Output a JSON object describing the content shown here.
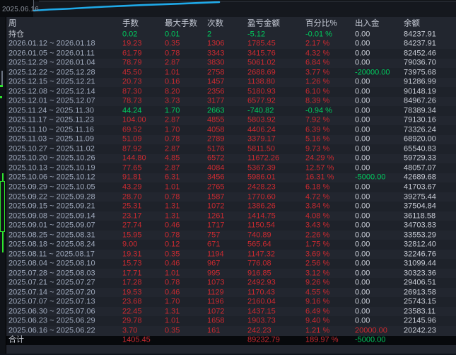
{
  "window": {
    "top_date_label": "2025.06.16"
  },
  "colors": {
    "profit_red": "#cb2a30",
    "loss_green": "#00ca5e",
    "neutral_text": "#c9cdd6",
    "equity_line_cyan": "#1fa9e8",
    "candle_green": "#2ee52e",
    "table_bg": "#22262f"
  },
  "table": {
    "headers": {
      "week": "周",
      "lots": "手数",
      "max_lots": "最大手数",
      "count": "次数",
      "pnl": "盈亏金额",
      "pct": "百分比%",
      "cashflow": "出入金",
      "balance": "余额"
    },
    "position_row": {
      "week": "持仓",
      "lots": "0.02",
      "max_lots": "0.01",
      "count": "2",
      "pnl": "-5.12",
      "pct": "-0.01 %",
      "cashflow": "0.00",
      "balance": "84237.91",
      "tone": "green",
      "cashflow_tone": "neutral"
    },
    "rows": [
      {
        "week": "2026.01.12 ~ 2026.01.18",
        "lots": "19.23",
        "max_lots": "0.35",
        "count": "1306",
        "pnl": "1785.45",
        "pct": "2.17 %",
        "cashflow": "0.00",
        "balance": "84237.91",
        "tone": "red",
        "cashflow_tone": "neutral"
      },
      {
        "week": "2026.01.05 ~ 2026.01.11",
        "lots": "61.79",
        "max_lots": "0.78",
        "count": "3343",
        "pnl": "3415.76",
        "pct": "4.32 %",
        "cashflow": "0.00",
        "balance": "82452.46",
        "tone": "red",
        "cashflow_tone": "neutral"
      },
      {
        "week": "2025.12.29 ~ 2026.01.04",
        "lots": "78.79",
        "max_lots": "2.87",
        "count": "3830",
        "pnl": "5061.02",
        "pct": "6.84 %",
        "cashflow": "0.00",
        "balance": "79036.70",
        "tone": "red",
        "cashflow_tone": "neutral"
      },
      {
        "week": "2025.12.22 ~ 2025.12.28",
        "lots": "45.50",
        "max_lots": "1.01",
        "count": "2758",
        "pnl": "2688.69",
        "pct": "3.77 %",
        "cashflow": "-20000.00",
        "balance": "73975.68",
        "tone": "red",
        "cashflow_tone": "green"
      },
      {
        "week": "2025.12.15 ~ 2025.12.21",
        "lots": "20.73",
        "max_lots": "0.16",
        "count": "1457",
        "pnl": "1138.80",
        "pct": "1.26 %",
        "cashflow": "0.00",
        "balance": "91286.99",
        "tone": "red",
        "cashflow_tone": "neutral"
      },
      {
        "week": "2025.12.08 ~ 2025.12.14",
        "lots": "87.30",
        "max_lots": "8.20",
        "count": "2356",
        "pnl": "5180.93",
        "pct": "6.10 %",
        "cashflow": "0.00",
        "balance": "90148.19",
        "tone": "red",
        "cashflow_tone": "neutral"
      },
      {
        "week": "2025.12.01 ~ 2025.12.07",
        "lots": "78.73",
        "max_lots": "3.73",
        "count": "3177",
        "pnl": "6577.92",
        "pct": "8.39 %",
        "cashflow": "0.00",
        "balance": "84967.26",
        "tone": "red",
        "cashflow_tone": "neutral"
      },
      {
        "week": "2025.11.24 ~ 2025.11.30",
        "lots": "44.24",
        "max_lots": "1.70",
        "count": "2663",
        "pnl": "-740.82",
        "pct": "-0.94 %",
        "cashflow": "0.00",
        "balance": "78389.34",
        "tone": "green",
        "cashflow_tone": "neutral"
      },
      {
        "week": "2025.11.17 ~ 2025.11.23",
        "lots": "104.00",
        "max_lots": "2.87",
        "count": "4855",
        "pnl": "5803.92",
        "pct": "7.92 %",
        "cashflow": "0.00",
        "balance": "79130.16",
        "tone": "red",
        "cashflow_tone": "neutral"
      },
      {
        "week": "2025.11.10 ~ 2025.11.16",
        "lots": "69.52",
        "max_lots": "1.70",
        "count": "4058",
        "pnl": "4406.24",
        "pct": "6.39 %",
        "cashflow": "0.00",
        "balance": "73326.24",
        "tone": "red",
        "cashflow_tone": "neutral"
      },
      {
        "week": "2025.11.03 ~ 2025.11.09",
        "lots": "51.09",
        "max_lots": "0.78",
        "count": "2789",
        "pnl": "3379.17",
        "pct": "5.16 %",
        "cashflow": "0.00",
        "balance": "68920.00",
        "tone": "red",
        "cashflow_tone": "neutral"
      },
      {
        "week": "2025.10.27 ~ 2025.11.02",
        "lots": "87.92",
        "max_lots": "2.87",
        "count": "5176",
        "pnl": "5811.50",
        "pct": "9.73 %",
        "cashflow": "0.00",
        "balance": "65540.83",
        "tone": "red",
        "cashflow_tone": "neutral"
      },
      {
        "week": "2025.10.20 ~ 2025.10.26",
        "lots": "144.80",
        "max_lots": "4.85",
        "count": "6572",
        "pnl": "11672.26",
        "pct": "24.29 %",
        "cashflow": "0.00",
        "balance": "59729.33",
        "tone": "red",
        "cashflow_tone": "neutral"
      },
      {
        "week": "2025.10.13 ~ 2025.10.19",
        "lots": "77.65",
        "max_lots": "2.87",
        "count": "4084",
        "pnl": "5367.39",
        "pct": "12.57 %",
        "cashflow": "0.00",
        "balance": "48057.07",
        "tone": "red",
        "cashflow_tone": "neutral"
      },
      {
        "week": "2025.10.06 ~ 2025.10.12",
        "lots": "91.81",
        "max_lots": "6.31",
        "count": "3456",
        "pnl": "5986.01",
        "pct": "16.31 %",
        "cashflow": "-5000.00",
        "balance": "42689.68",
        "tone": "red",
        "cashflow_tone": "green"
      },
      {
        "week": "2025.09.29 ~ 2025.10.05",
        "lots": "43.29",
        "max_lots": "1.01",
        "count": "2765",
        "pnl": "2428.23",
        "pct": "6.18 %",
        "cashflow": "0.00",
        "balance": "41703.67",
        "tone": "red",
        "cashflow_tone": "neutral"
      },
      {
        "week": "2025.09.22 ~ 2025.09.28",
        "lots": "28.70",
        "max_lots": "0.78",
        "count": "1587",
        "pnl": "1770.60",
        "pct": "4.72 %",
        "cashflow": "0.00",
        "balance": "39275.44",
        "tone": "red",
        "cashflow_tone": "neutral"
      },
      {
        "week": "2025.09.15 ~ 2025.09.21",
        "lots": "25.31",
        "max_lots": "1.31",
        "count": "1072",
        "pnl": "1386.26",
        "pct": "3.84 %",
        "cashflow": "0.00",
        "balance": "37504.84",
        "tone": "red",
        "cashflow_tone": "neutral"
      },
      {
        "week": "2025.09.08 ~ 2025.09.14",
        "lots": "23.17",
        "max_lots": "1.31",
        "count": "1261",
        "pnl": "1414.75",
        "pct": "4.08 %",
        "cashflow": "0.00",
        "balance": "36118.58",
        "tone": "red",
        "cashflow_tone": "neutral"
      },
      {
        "week": "2025.09.01 ~ 2025.09.07",
        "lots": "27.74",
        "max_lots": "0.46",
        "count": "1717",
        "pnl": "1150.54",
        "pct": "3.43 %",
        "cashflow": "0.00",
        "balance": "34703.83",
        "tone": "red",
        "cashflow_tone": "neutral"
      },
      {
        "week": "2025.08.25 ~ 2025.08.31",
        "lots": "15.95",
        "max_lots": "0.78",
        "count": "757",
        "pnl": "740.89",
        "pct": "2.26 %",
        "cashflow": "0.00",
        "balance": "33553.29",
        "tone": "red",
        "cashflow_tone": "neutral"
      },
      {
        "week": "2025.08.18 ~ 2025.08.24",
        "lots": "9.00",
        "max_lots": "0.12",
        "count": "671",
        "pnl": "565.64",
        "pct": "1.75 %",
        "cashflow": "0.00",
        "balance": "32812.40",
        "tone": "red",
        "cashflow_tone": "neutral"
      },
      {
        "week": "2025.08.11 ~ 2025.08.17",
        "lots": "19.31",
        "max_lots": "0.35",
        "count": "1194",
        "pnl": "1147.32",
        "pct": "3.69 %",
        "cashflow": "0.00",
        "balance": "32246.76",
        "tone": "red",
        "cashflow_tone": "neutral"
      },
      {
        "week": "2025.08.04 ~ 2025.08.10",
        "lots": "15.73",
        "max_lots": "0.46",
        "count": "967",
        "pnl": "776.08",
        "pct": "2.56 %",
        "cashflow": "0.00",
        "balance": "31099.44",
        "tone": "red",
        "cashflow_tone": "neutral"
      },
      {
        "week": "2025.07.28 ~ 2025.08.03",
        "lots": "17.71",
        "max_lots": "1.01",
        "count": "995",
        "pnl": "916.85",
        "pct": "3.12 %",
        "cashflow": "0.00",
        "balance": "30323.36",
        "tone": "red",
        "cashflow_tone": "neutral"
      },
      {
        "week": "2025.07.21 ~ 2025.07.27",
        "lots": "17.28",
        "max_lots": "0.78",
        "count": "1073",
        "pnl": "2492.93",
        "pct": "9.26 %",
        "cashflow": "0.00",
        "balance": "29406.51",
        "tone": "red",
        "cashflow_tone": "neutral"
      },
      {
        "week": "2025.07.14 ~ 2025.07.20",
        "lots": "19.53",
        "max_lots": "0.46",
        "count": "1129",
        "pnl": "1170.43",
        "pct": "4.55 %",
        "cashflow": "0.00",
        "balance": "26913.58",
        "tone": "red",
        "cashflow_tone": "neutral"
      },
      {
        "week": "2025.07.07 ~ 2025.07.13",
        "lots": "23.68",
        "max_lots": "1.70",
        "count": "1196",
        "pnl": "2160.04",
        "pct": "9.16 %",
        "cashflow": "0.00",
        "balance": "25743.15",
        "tone": "red",
        "cashflow_tone": "neutral"
      },
      {
        "week": "2025.06.30 ~ 2025.07.06",
        "lots": "22.45",
        "max_lots": "1.31",
        "count": "1072",
        "pnl": "1437.15",
        "pct": "6.49 %",
        "cashflow": "0.00",
        "balance": "23583.11",
        "tone": "red",
        "cashflow_tone": "neutral"
      },
      {
        "week": "2025.06.23 ~ 2025.06.29",
        "lots": "29.78",
        "max_lots": "1.01",
        "count": "1658",
        "pnl": "1903.73",
        "pct": "9.40 %",
        "cashflow": "0.00",
        "balance": "22145.96",
        "tone": "red",
        "cashflow_tone": "neutral"
      },
      {
        "week": "2025.06.16 ~ 2025.06.22",
        "lots": "3.70",
        "max_lots": "0.35",
        "count": "161",
        "pnl": "242.23",
        "pct": "1.21 %",
        "cashflow": "20000.00",
        "balance": "20242.23",
        "tone": "red",
        "cashflow_tone": "red"
      }
    ],
    "total_row": {
      "week": "合计",
      "lots": "1405.45",
      "max_lots": "",
      "count": "",
      "pnl": "89232.79",
      "pct": "189.97 %",
      "cashflow": "-5000.00",
      "balance": "",
      "tone": "red",
      "cashflow_tone": "green"
    }
  }
}
